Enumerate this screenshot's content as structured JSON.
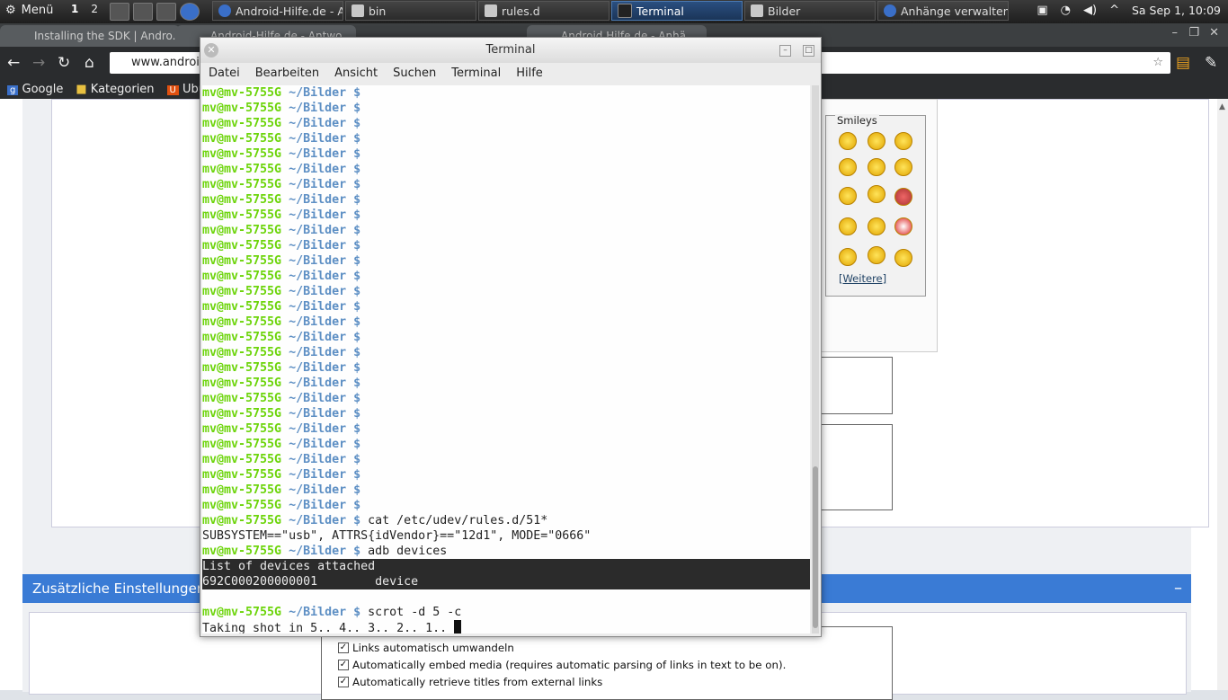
{
  "taskbar": {
    "menu_label": "Menü",
    "workspaces": [
      "1",
      "2"
    ],
    "tasks": [
      {
        "label": "Android-Hilfe.de - A...",
        "icon": "chromium-icon",
        "active": false
      },
      {
        "label": "bin",
        "icon": "folder-icon",
        "active": false
      },
      {
        "label": "rules.d",
        "icon": "folder-icon",
        "active": false
      },
      {
        "label": "Terminal",
        "icon": "terminal-icon",
        "active": true
      },
      {
        "label": "Bilder",
        "icon": "folder-icon",
        "active": false
      },
      {
        "label": "Anhänge verwalten ...",
        "icon": "chromium-icon",
        "active": false
      }
    ],
    "clock": "Sa Sep  1, 10:09"
  },
  "browser": {
    "tabs": [
      "Installing the SDK | Andro...",
      "Android-Hilfe.de - Antwo...",
      "",
      "Android Hilfe.de - Anhä..."
    ],
    "address": "www.android",
    "bookmarks": [
      "Google",
      "Kategorien",
      "Ubuntu"
    ]
  },
  "page": {
    "smileys_legend": "Smileys",
    "smileys_more": "[Weitere]",
    "section_title": "Zusätzliche Einstellungen",
    "options": [
      "Links automatisch umwandeln",
      "Automatically embed media (requires automatic parsing of links in text to be on).",
      "Automatically retrieve titles from external links"
    ]
  },
  "terminal": {
    "title": "Terminal",
    "menu": [
      "Datei",
      "Bearbeiten",
      "Ansicht",
      "Suchen",
      "Terminal",
      "Hilfe"
    ],
    "prompt_user": "mv@mv-5755G",
    "prompt_path": "~/Bilder $",
    "empty_prompts": 28,
    "cmd1": "cat /etc/udev/rules.d/51*",
    "out1": "SUBSYSTEM==\"usb\", ATTRS{idVendor}==\"12d1\", MODE=\"0666\"",
    "cmd2": "adb devices",
    "out2a": "List of devices attached",
    "out2b": "692C000200000001        device",
    "cmd3": "scrot -d 5 -c",
    "out3": "Taking shot in 5.. 4.. 3.. 2.. 1.. "
  }
}
